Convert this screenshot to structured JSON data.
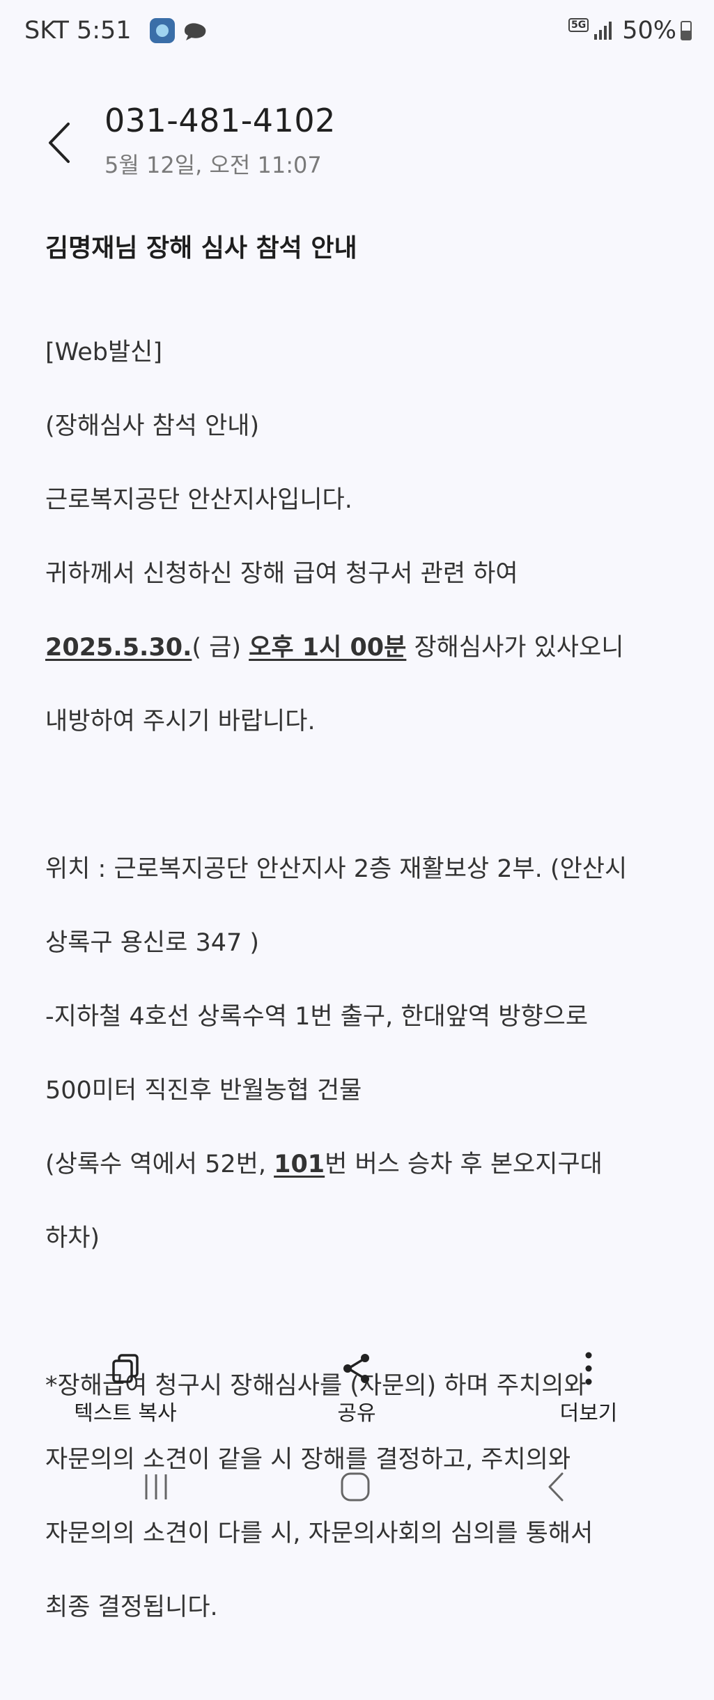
{
  "status_bar": {
    "carrier_time": "SKT 5:51",
    "network": "5G",
    "battery": "50%",
    "battery_level": 0.5
  },
  "header": {
    "title": "031-481-4102",
    "subtitle": "5월 12일, 오전 11:07"
  },
  "message": {
    "title": "김명재님 장해 심사 참석 안내",
    "p1": {
      "line1": "[Web발신]",
      "line2": "(장해심사 참석 안내)",
      "line3": "근로복지공단 안산지사입니다.",
      "line4": "귀하께서 신청하신 장해 급여 청구서 관련 하여",
      "date": "2025.5.30.",
      "day": "( 금) ",
      "time": "오후 1시 00분",
      "after_time": " 장해심사가 있사오니",
      "line6": "내방하여 주시기 바랍니다."
    },
    "p2": {
      "line1": "위치 : 근로복지공단 안산지사  2층 재활보상 2부.  (안산시",
      "line2": "상록구 용신로 347 )",
      "line3": "-지하철 4호선 상록수역 1번 출구, 한대앞역 방향으로",
      "line4": "500미터 직진후 반월농협 건물",
      "line5_before": "(상록수 역에서 52번, ",
      "line5_bus": "101",
      "line5_after": "번 버스 승차 후 본오지구대",
      "line6": "하차)"
    },
    "p3": {
      "line1": "*장해급여 청구시  장해심사를 (자문의)  하며 주치의와",
      "line2": "자문의의 소견이 같을 시 장해를 결정하고, 주치의와",
      "line3": "자문의의 소견이 다를 시, 자문의사회의 심의를 통해서",
      "line4": "최종 결정됩니다."
    }
  },
  "actions": {
    "copy_label": "텍스트 복사",
    "share_label": "공유",
    "more_label": "더보기"
  }
}
